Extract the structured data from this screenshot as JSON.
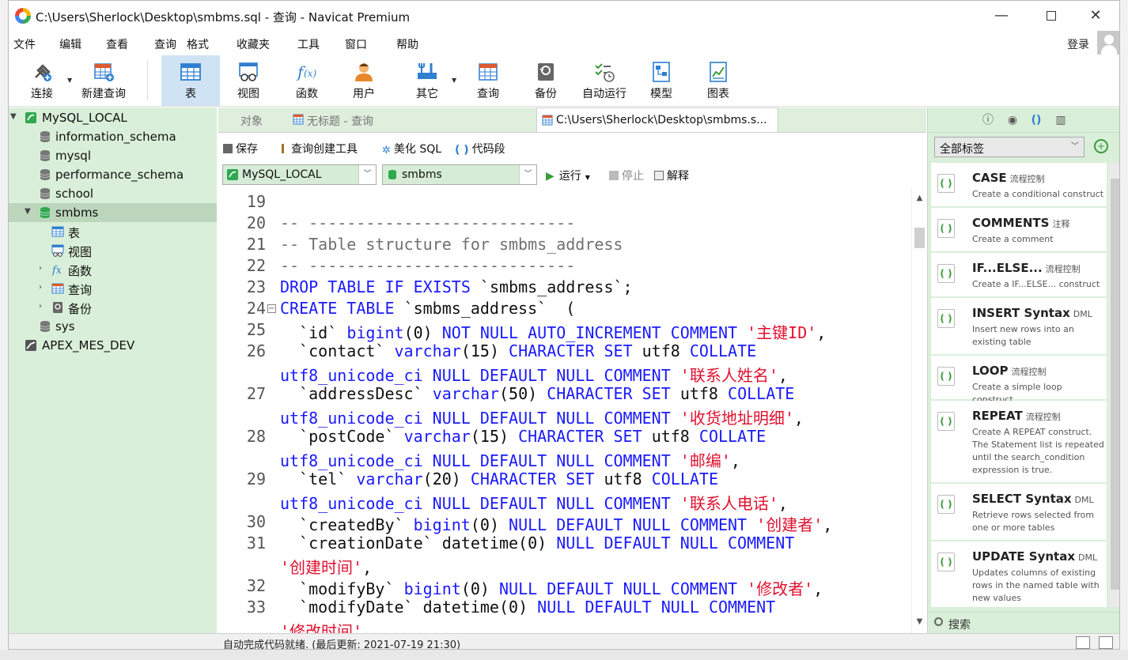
{
  "window": {
    "title": "C:\\Users\\Sherlock\\Desktop\\smbms.sql - 查询 - Navicat Premium"
  },
  "menu": [
    "文件",
    "编辑",
    "查看",
    "查询",
    "格式",
    "收藏夹",
    "工具",
    "窗口",
    "帮助"
  ],
  "login_label": "登录",
  "toolbar": {
    "connect": "连接",
    "new_query": "新建查询",
    "table": "表",
    "view": "视图",
    "function": "函数",
    "user": "用户",
    "other": "其它",
    "query": "查询",
    "backup": "备份",
    "auto_run": "自动运行",
    "model": "模型",
    "chart": "图表"
  },
  "nav": {
    "root": "MySQL_LOCAL",
    "databases": [
      "information_schema",
      "mysql",
      "performance_schema",
      "school",
      "smbms"
    ],
    "smbms_children": [
      "表",
      "视图",
      "函数",
      "查询",
      "备份"
    ],
    "after": [
      "sys"
    ],
    "other_conn": "APEX_MES_DEV"
  },
  "tabs": {
    "objects": "对象",
    "untitled": "无标题 - 查询",
    "active": "C:\\Users\\Sherlock\\Desktop\\smbms.s..."
  },
  "query_toolbar": {
    "save": "保存",
    "builder": "查询创建工具",
    "beautify": "美化 SQL",
    "snippet": "代码段",
    "run": "运行",
    "stop": "停止",
    "explain": "解释"
  },
  "selectors": {
    "connection": "MySQL_LOCAL",
    "database": "smbms"
  },
  "editor": {
    "line_numbers": [
      "19",
      "20",
      "21",
      "22",
      "23",
      "24",
      "25",
      "26",
      "27",
      "28",
      "29",
      "30",
      "31",
      "32",
      "33"
    ],
    "lines": [
      "",
      "-- ----------------------------",
      "-- Table structure for smbms_address",
      "-- ----------------------------",
      "DROP TABLE IF EXISTS `smbms_address`;",
      "CREATE TABLE `smbms_address`  (",
      "  `id` bigint(0) NOT NULL AUTO_INCREMENT COMMENT '主键ID',",
      "  `contact` varchar(15) CHARACTER SET utf8 COLLATE",
      "utf8_unicode_ci NULL DEFAULT NULL COMMENT '联系人姓名',",
      "  `addressDesc` varchar(50) CHARACTER SET utf8 COLLATE",
      "utf8_unicode_ci NULL DEFAULT NULL COMMENT '收货地址明细',",
      "  `postCode` varchar(15) CHARACTER SET utf8 COLLATE",
      "utf8_unicode_ci NULL DEFAULT NULL COMMENT '邮编',",
      "  `tel` varchar(20) CHARACTER SET utf8 COLLATE",
      "utf8_unicode_ci NULL DEFAULT NULL COMMENT '联系人电话',",
      "  `createdBy` bigint(0) NULL DEFAULT NULL COMMENT '创建者',",
      "  `creationDate` datetime(0) NULL DEFAULT NULL COMMENT",
      "'创建时间',",
      "  `modifyBy` bigint(0) NULL DEFAULT NULL COMMENT '修改者',",
      "  `modifyDate` datetime(0) NULL DEFAULT NULL COMMENT",
      "'修改时间',"
    ]
  },
  "right_panel": {
    "filter": "全部标签",
    "search": "搜索",
    "snippets": [
      {
        "title": "CASE",
        "cat": "流程控制",
        "desc": "Create a conditional construct"
      },
      {
        "title": "COMMENTS",
        "cat": "注释",
        "desc": "Create a comment"
      },
      {
        "title": "IF...ELSE...",
        "cat": "流程控制",
        "desc": "Create a IF...ELSE... construct"
      },
      {
        "title": "INSERT Syntax",
        "cat": "DML",
        "desc": "Insert new rows into an existing table"
      },
      {
        "title": "LOOP",
        "cat": "流程控制",
        "desc": "Create a simple loop construct"
      },
      {
        "title": "REPEAT",
        "cat": "流程控制",
        "desc": "Create A REPEAT construct. The Statement list is repeated until the search_condition expression is true."
      },
      {
        "title": "SELECT Syntax",
        "cat": "DML",
        "desc": "Retrieve rows selected from one or more tables"
      },
      {
        "title": "UPDATE Syntax",
        "cat": "DML",
        "desc": "Updates columns of existing rows in the named table with new values"
      }
    ]
  },
  "status": {
    "text": "自动完成代码就绪. (最后更新: 2021-07-19 21:30)"
  },
  "colors": {
    "nav_bg": "#d9efd9",
    "keyword": "#1a1aff",
    "string": "#e0102e",
    "comment": "#707070",
    "active_btn": "#cfe3f5"
  }
}
